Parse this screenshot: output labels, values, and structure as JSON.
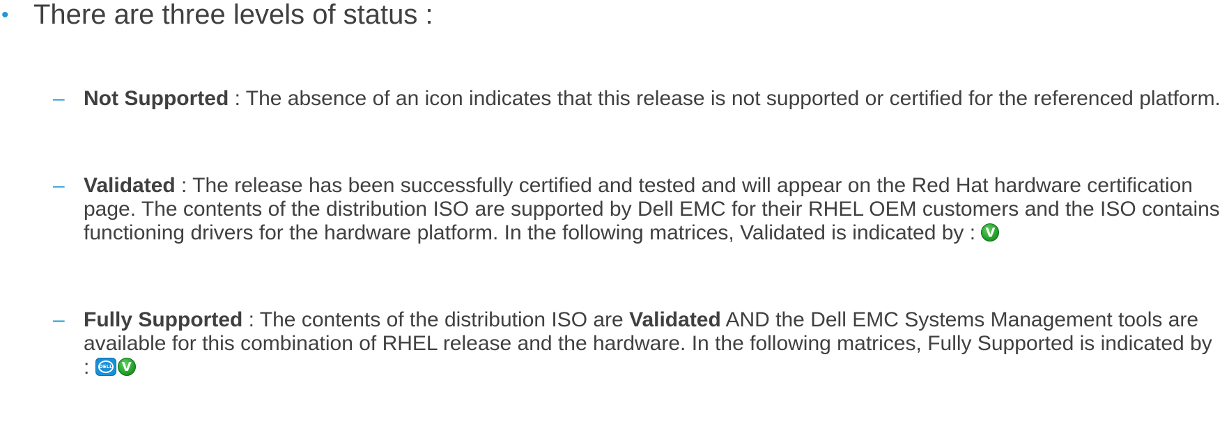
{
  "main": {
    "bullet": "•",
    "heading": "There are three levels of status :"
  },
  "items": [
    {
      "dash": "–",
      "term": "Not Supported",
      "text": " : The absence of an icon indicates that this release is not supported or certified for the referenced platform."
    },
    {
      "dash": "–",
      "term": "Validated",
      "text": " : The release has been successfully certified and tested and will appear on the Red Hat hardware certification page. The contents of the distribution ISO are supported by Dell EMC for their RHEL OEM customers and the ISO contains functioning drivers for the hardware platform. In the following matrices, Validated is indicated by : ",
      "icons": [
        "validated-icon"
      ]
    },
    {
      "dash": "–",
      "term": "Fully Supported",
      "text_a": " : The contents of the distribution ISO are ",
      "term2": "Validated",
      "text_b": " AND the Dell EMC Systems Management tools are available for this combination of RHEL release and the hardware. In the following matrices, Fully Supported is indicated by : ",
      "icons": [
        "dell-icon",
        "validated-icon"
      ]
    }
  ],
  "icon_labels": {
    "validated": "V",
    "dell": "DELL"
  },
  "colors": {
    "text": "#404040",
    "accent": "#1f9ad6",
    "validated_green": "#26a52e",
    "dell_blue": "#1a8fd8"
  }
}
